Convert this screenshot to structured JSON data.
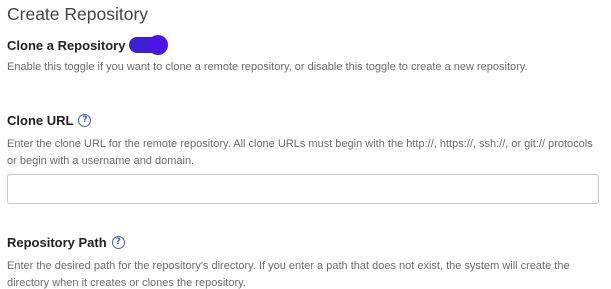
{
  "page": {
    "title": "Create Repository"
  },
  "clone_toggle": {
    "label": "Clone a Repository",
    "state": "on",
    "accent_color": "#3d1fd6",
    "help": "Enable this toggle if you want to clone a remote repository, or disable this toggle to create a new repository."
  },
  "clone_url": {
    "label": "Clone URL",
    "help_icon": "question-circle-icon",
    "help": "Enter the clone URL for the remote repository. All clone URLs must begin with the http://, https://, ssh://, or git:// protocols or begin with a username and domain.",
    "value": ""
  },
  "repository_path": {
    "label": "Repository Path",
    "help_icon": "question-circle-icon",
    "help": "Enter the desired path for the repository's directory. If you enter a path that does not exist, the system will create the directory when it creates or clones the repository."
  }
}
